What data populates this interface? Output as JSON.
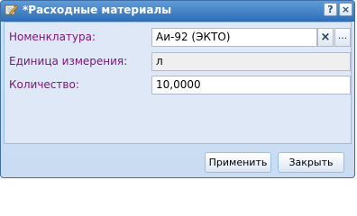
{
  "window": {
    "title": "*Расходные материалы",
    "help_label": "?",
    "close_label": "×"
  },
  "form": {
    "fields": [
      {
        "label": "Номенклатура:",
        "value": "Аи-92 (ЭКТО)"
      },
      {
        "label": "Единица измерения:",
        "value": "л"
      },
      {
        "label": "Количество:",
        "value": "10,0000"
      }
    ],
    "clear_label": "×",
    "browse_label": "..."
  },
  "buttons": {
    "apply": "Применить",
    "close": "Закрыть"
  }
}
